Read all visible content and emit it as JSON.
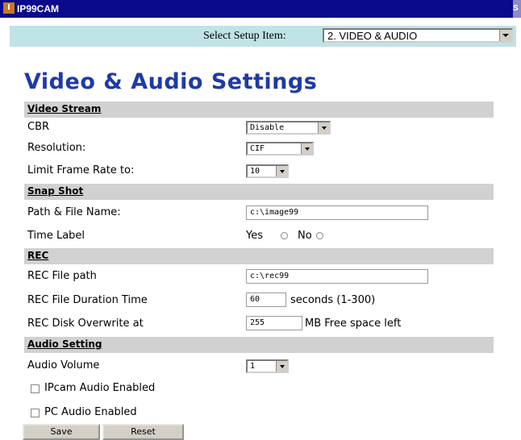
{
  "app": {
    "title": "IP99CAM",
    "logo_letter": "I",
    "edge_letter": "S"
  },
  "setup": {
    "label": "Select Setup Item:",
    "selected": "2. VIDEO & AUDIO"
  },
  "page_title": "Video & Audio Settings",
  "video_stream": {
    "heading": "Video Stream",
    "cbr_label": "CBR",
    "cbr_value": "Disable",
    "resolution_label": "Resolution:",
    "resolution_value": "CIF",
    "frame_rate_label": "Limit Frame Rate to:",
    "frame_rate_value": "10"
  },
  "snap_shot": {
    "heading": "Snap Shot",
    "path_label": "Path & File Name:",
    "path_value": "c:\\image99",
    "time_label": "Time Label",
    "yes": "Yes",
    "no": "No"
  },
  "rec": {
    "heading": "REC",
    "path_label": "REC File path",
    "path_value": "c:\\rec99",
    "duration_label": "REC File Duration Time",
    "duration_value": "60",
    "duration_suffix": "seconds (1-300)",
    "overwrite_label": "REC Disk Overwrite at",
    "overwrite_value": "255",
    "overwrite_suffix": "MB Free space left"
  },
  "audio": {
    "heading": "Audio Setting",
    "volume_label": "Audio Volume",
    "volume_value": "1",
    "ipcam_label": "IPcam Audio Enabled",
    "pc_label": "PC Audio Enabled"
  },
  "buttons": {
    "save": "Save",
    "reset": "Reset"
  }
}
